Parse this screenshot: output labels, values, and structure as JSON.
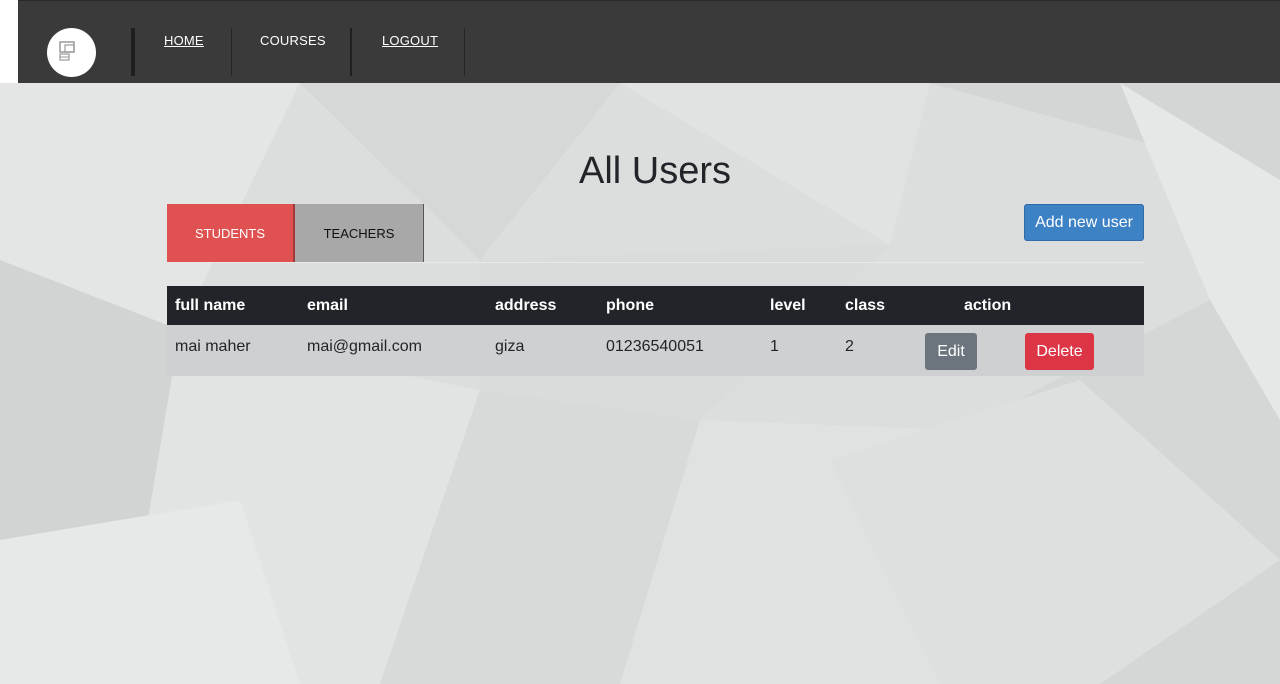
{
  "nav": {
    "logo": "logo",
    "links": [
      {
        "label": "HOME"
      },
      {
        "label": "COURSES"
      },
      {
        "label": "LOGOUT"
      }
    ]
  },
  "main": {
    "title": "All Users",
    "tabs": [
      {
        "label": "STUDENTS",
        "active": true
      },
      {
        "label": "TEACHERS",
        "active": false
      }
    ],
    "add_button": "Add new user"
  },
  "table": {
    "columns": [
      "full name",
      "email",
      "address",
      "phone",
      "level",
      "class",
      "action"
    ],
    "rows": [
      {
        "full_name": "mai maher",
        "email": "mai@gmail.com",
        "address": "giza",
        "phone": "01236540051",
        "level": "1",
        "class": "2",
        "edit_label": "Edit",
        "delete_label": "Delete"
      }
    ]
  },
  "colors": {
    "navbar": "#3a3a3a",
    "tab_active": "#e05252",
    "tab_inactive": "#a8a8a8",
    "primary": "#3d82c5",
    "table_header": "#212529",
    "edit_button": "#6c757d",
    "delete_button": "#dc3545"
  }
}
